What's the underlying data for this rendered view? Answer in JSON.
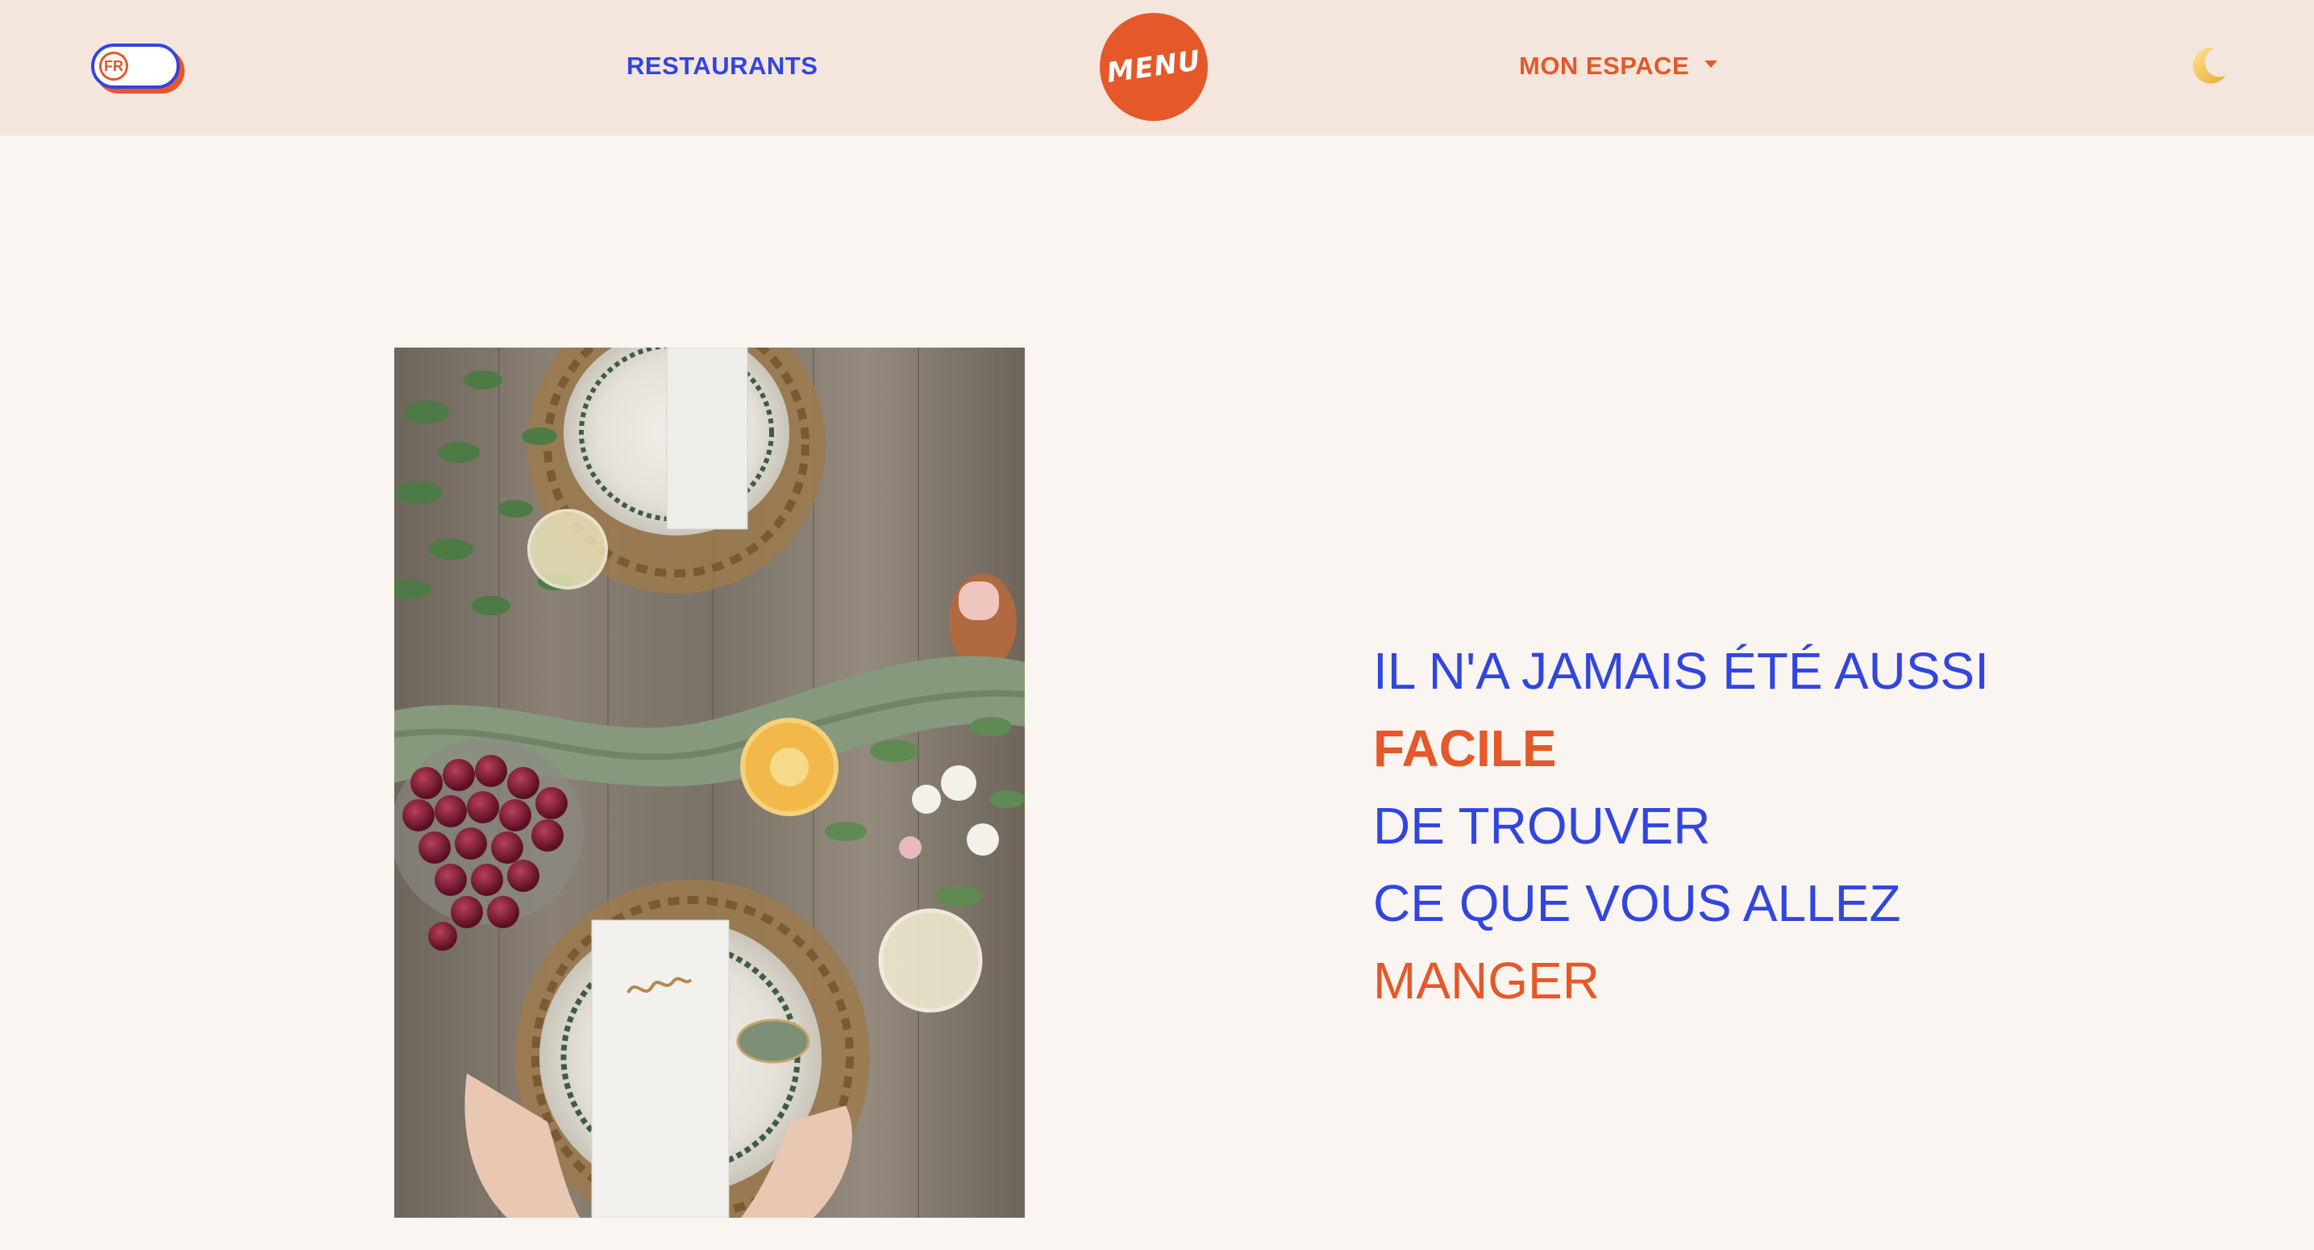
{
  "header": {
    "lang_label": "FR",
    "nav_restaurants": "RESTAURANTS",
    "logo_text": "MENU",
    "nav_mon_espace": "MON ESPACE",
    "theme_icon": "moon-icon"
  },
  "colors": {
    "accent_blue": "#3145e0",
    "accent_orange": "#e4582a",
    "header_bg": "#f4e6dd",
    "page_bg": "#faf5f0"
  },
  "hero": {
    "line1": "IL N'A JAMAIS ÉTÉ AUSSI",
    "line2": "FACILE",
    "line3": "DE TROUVER",
    "line4": "CE QUE VOUS ALLEZ",
    "line5": "MANGER"
  }
}
